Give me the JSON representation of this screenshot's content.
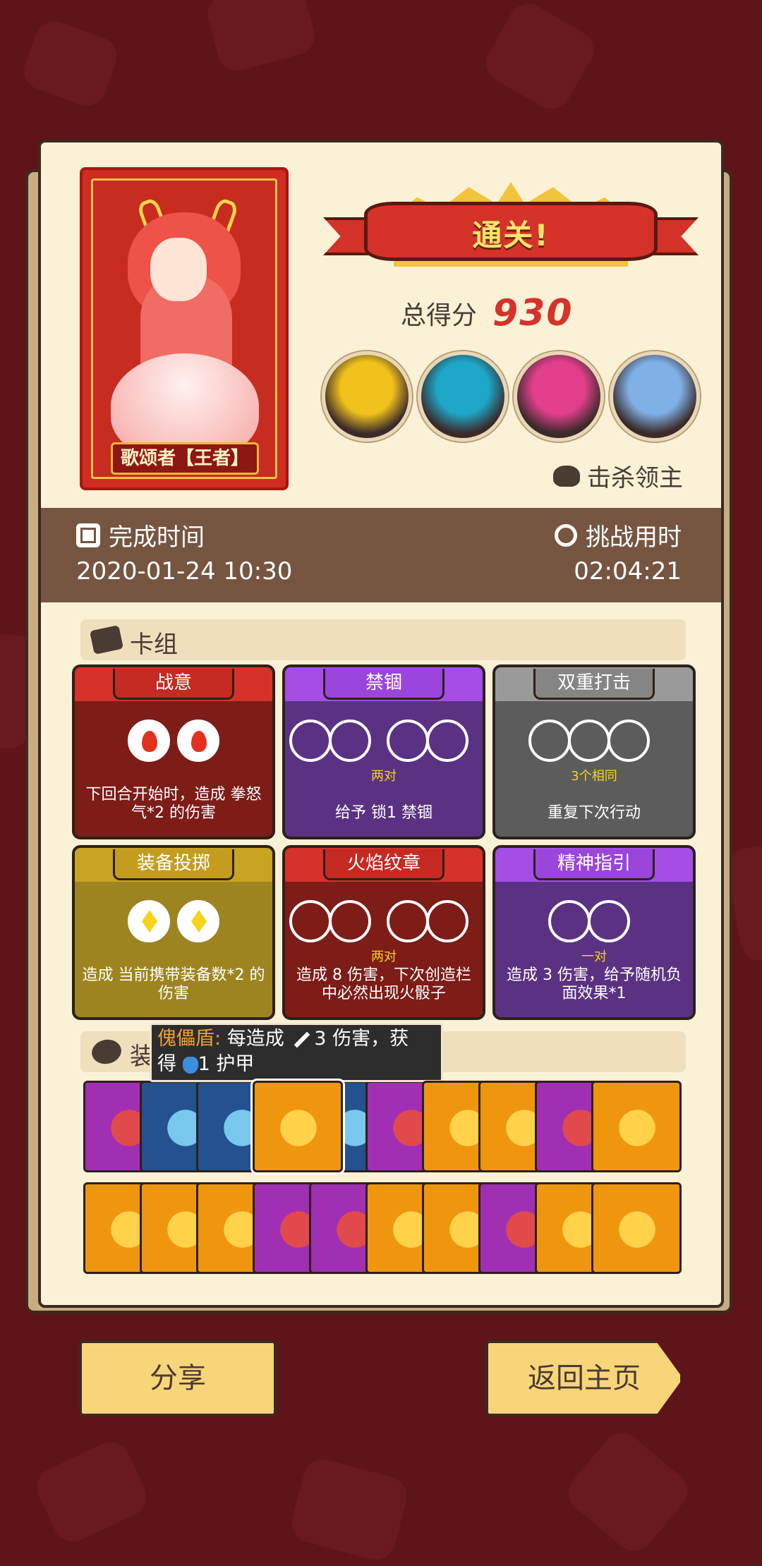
{
  "result_banner": "通关!",
  "hero": {
    "name": "歌颂者【王者】"
  },
  "score": {
    "label": "总得分",
    "value": "930"
  },
  "bosses_label": "击杀领主",
  "bosses": [
    {
      "icon": "boss-straw-hat-icon",
      "color": "#f2c21c"
    },
    {
      "icon": "boss-shadow-icon",
      "color": "#1ea7c9"
    },
    {
      "icon": "boss-mask-icon",
      "color": "#e23f8c"
    },
    {
      "icon": "boss-skull-king-icon",
      "color": "#7fb0e6"
    }
  ],
  "completion": {
    "label": "完成时间",
    "value": "2020-01-24 10:30"
  },
  "challenge": {
    "label": "挑战用时",
    "value": "02:04:21"
  },
  "deck_title": "卡组",
  "cards": [
    {
      "title": "战意",
      "theme": "red",
      "dice": "fire2",
      "cond": "",
      "desc": "下回合开始时，造成 拳怒气*2 的伤害"
    },
    {
      "title": "禁锢",
      "theme": "purple",
      "dice": "pairs",
      "cond": "两对",
      "desc": "给予 锁1 禁锢"
    },
    {
      "title": "双重打击",
      "theme": "gray",
      "dice": "three",
      "cond": "3个相同",
      "desc": "重复下次行动"
    },
    {
      "title": "装备投掷",
      "theme": "olive",
      "dice": "gold2",
      "cond": "",
      "desc": "造成 当前携带装备数*2 的伤害"
    },
    {
      "title": "火焰纹章",
      "theme": "red",
      "dice": "pairs",
      "cond": "两对",
      "desc": "造成 8 伤害，下次创造栏中必然出现火骰子"
    },
    {
      "title": "精神指引",
      "theme": "purple",
      "dice": "pair",
      "cond": "一对",
      "desc": "造成 3 伤害，给予随机负面效果*1"
    }
  ],
  "equip_title": "装备",
  "tooltip": {
    "name": "傀儡盾:",
    "line1": "每造成",
    "dmg": "3",
    "line1b": "伤害，获",
    "line2a": "得",
    "armor": "1",
    "line2b": "护甲"
  },
  "items_row1": [
    {
      "icon": "red-ring-icon",
      "bg": "purple"
    },
    {
      "icon": "top-hat-icon",
      "bg": "blue"
    },
    {
      "icon": "ice-crown-icon",
      "bg": "blue"
    },
    {
      "icon": "puppet-shield-icon",
      "bg": "orange"
    },
    {
      "icon": "scroll-icon",
      "bg": "blue"
    },
    {
      "icon": "skull-scroll-icon",
      "bg": "purple"
    },
    {
      "icon": "golden-helmet-icon",
      "bg": "orange"
    },
    {
      "icon": "gold-crown-icon",
      "bg": "orange"
    },
    {
      "icon": "emerald-icon",
      "bg": "purple"
    },
    {
      "icon": "green-potion-icon",
      "bg": "orange"
    }
  ],
  "items_row2": [
    {
      "icon": "spiked-armor-icon",
      "bg": "orange"
    },
    {
      "icon": "axe-icon",
      "bg": "orange"
    },
    {
      "icon": "crystal-icon",
      "bg": "orange"
    },
    {
      "icon": "heart-amulet-icon",
      "bg": "purple"
    },
    {
      "icon": "gold-ring-icon",
      "bg": "purple"
    },
    {
      "icon": "spiked-ball-icon",
      "bg": "orange"
    },
    {
      "icon": "red-bracer-icon",
      "bg": "orange"
    },
    {
      "icon": "purple-scarf-icon",
      "bg": "purple"
    },
    {
      "icon": "green-skull-icon",
      "bg": "orange"
    },
    {
      "icon": "lion-ring-icon",
      "bg": "orange"
    }
  ],
  "buttons": {
    "share": "分享",
    "home": "返回主页"
  }
}
